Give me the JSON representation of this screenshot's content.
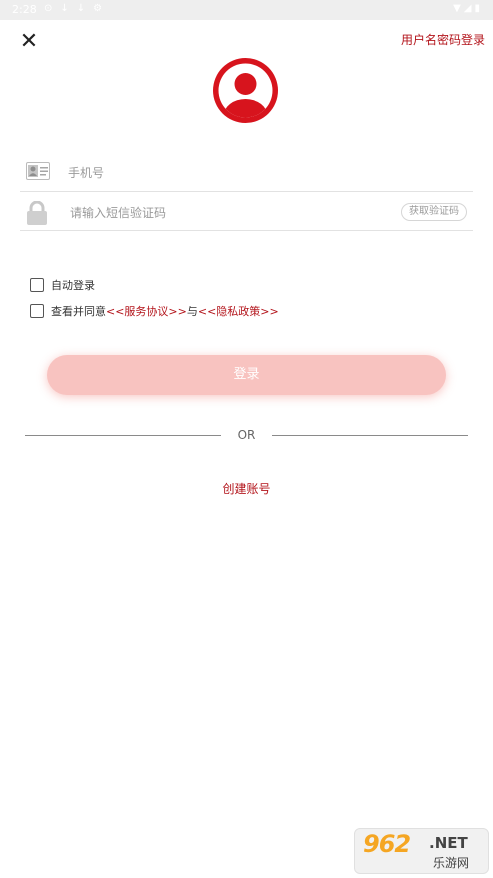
{
  "status_bar": {
    "time": "2:28",
    "icons": [
      "notification-icon",
      "download-icon",
      "download-icon",
      "settings-icon"
    ],
    "right_icons": [
      "wifi-icon",
      "signal-icon",
      "battery-icon"
    ]
  },
  "header": {
    "close_icon": "✕",
    "alt_login_label": "用户名密码登录"
  },
  "avatar": {
    "icon": "user-avatar-icon",
    "color": "#d7141d"
  },
  "form": {
    "phone_placeholder": "手机号",
    "code_placeholder": "请输入短信验证码",
    "get_code_label": "获取验证码"
  },
  "options": {
    "auto_login_label": "自动登录",
    "auto_login_checked": false,
    "agree_prefix": "查看并同意",
    "service_agreement": "<<服务协议>>",
    "agree_conjunction": "与",
    "privacy_policy": "<<隐私政策>>",
    "agree_checked": false
  },
  "login_button": "登录",
  "divider_text": "OR",
  "create_account": "创建账号",
  "watermark": {
    "main": "962",
    "net": ".NET",
    "sub": "乐游网"
  },
  "colors": {
    "accent": "#b3141b",
    "avatar_red": "#d7141d",
    "login_button_bg": "#f8c3c0"
  }
}
